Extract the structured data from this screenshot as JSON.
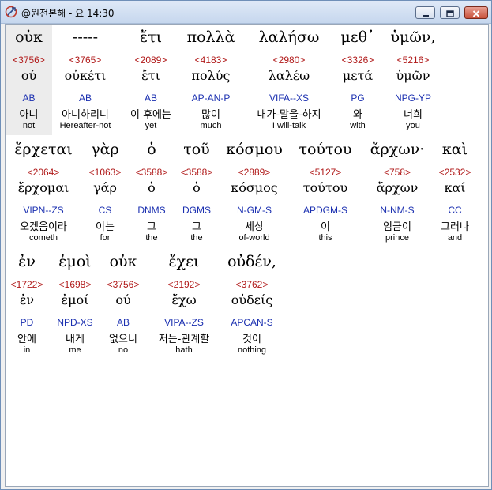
{
  "window": {
    "title": "@원전본해 - 요 14:30"
  },
  "colors": {
    "strongs": "#b01818",
    "parsing": "#1a2fb0",
    "text": "#000000"
  },
  "words": [
    {
      "greek": "οὐκ",
      "strongs": "<3756>",
      "lemma": "ού",
      "parse": "AB",
      "korean": "아니",
      "english": "not"
    },
    {
      "greek": "-----",
      "strongs": "<3765>",
      "lemma": "οὐκέτι",
      "parse": "AB",
      "korean": "아니하리니",
      "english": "Hereafter-not"
    },
    {
      "greek": "ἔτι",
      "strongs": "<2089>",
      "lemma": "ἔτι",
      "parse": "AB",
      "korean": "이 후에는",
      "english": "yet"
    },
    {
      "greek": "πολλὰ",
      "strongs": "<4183>",
      "lemma": "πολύς",
      "parse": "AP-AN-P",
      "korean": "많이",
      "english": "much"
    },
    {
      "greek": "λαλήσω",
      "strongs": "<2980>",
      "lemma": "λαλέω",
      "parse": "VIFA--XS",
      "korean": "내가-말을-하지",
      "english": "I will-talk"
    },
    {
      "greek": "μεθ᾽",
      "strongs": "<3326>",
      "lemma": "μετά",
      "parse": "PG",
      "korean": "와",
      "english": "with"
    },
    {
      "greek": "ὑμῶν,",
      "strongs": "<5216>",
      "lemma": "ὑμῶν",
      "parse": "NPG-YP",
      "korean": "너희",
      "english": "you"
    },
    {
      "greek": "ἔρχεται",
      "strongs": "<2064>",
      "lemma": "ἔρχομαι",
      "parse": "VIPN--ZS",
      "korean": "오겠음이라",
      "english": "cometh"
    },
    {
      "greek": "γὰρ",
      "strongs": "<1063>",
      "lemma": "γάρ",
      "parse": "CS",
      "korean": "이는",
      "english": "for"
    },
    {
      "greek": "ὁ",
      "strongs": "<3588>",
      "lemma": "ὁ",
      "parse": "DNMS",
      "korean": "그",
      "english": "the"
    },
    {
      "greek": "τοῦ",
      "strongs": "<3588>",
      "lemma": "ὁ",
      "parse": "DGMS",
      "korean": "그",
      "english": "the"
    },
    {
      "greek": "κόσμου",
      "strongs": "<2889>",
      "lemma": "κόσμος",
      "parse": "N-GM-S",
      "korean": "세상",
      "english": "of-world"
    },
    {
      "greek": "τούτου",
      "strongs": "<5127>",
      "lemma": "τούτου",
      "parse": "APDGM-S",
      "korean": "이",
      "english": "this"
    },
    {
      "greek": "ἄρχων·",
      "strongs": "<758>",
      "lemma": "ἄρχων",
      "parse": "N-NM-S",
      "korean": "임금이",
      "english": "prince"
    },
    {
      "greek": "καὶ",
      "strongs": "<2532>",
      "lemma": "καί",
      "parse": "CC",
      "korean": "그러나",
      "english": "and"
    },
    {
      "greek": "ἐν",
      "strongs": "<1722>",
      "lemma": "ἐν",
      "parse": "PD",
      "korean": "안에",
      "english": "in"
    },
    {
      "greek": "ἐμοὶ",
      "strongs": "<1698>",
      "lemma": "ἐμοί",
      "parse": "NPD-XS",
      "korean": "내게",
      "english": "me"
    },
    {
      "greek": "οὐκ",
      "strongs": "<3756>",
      "lemma": "ού",
      "parse": "AB",
      "korean": "없으니",
      "english": "no"
    },
    {
      "greek": "ἔχει",
      "strongs": "<2192>",
      "lemma": "ἔχω",
      "parse": "VIPA--ZS",
      "korean": "저는-관계할",
      "english": "hath"
    },
    {
      "greek": "οὐδέν,",
      "strongs": "<3762>",
      "lemma": "οὐδείς",
      "parse": "APCAN-S",
      "korean": "것이",
      "english": "nothing"
    }
  ]
}
